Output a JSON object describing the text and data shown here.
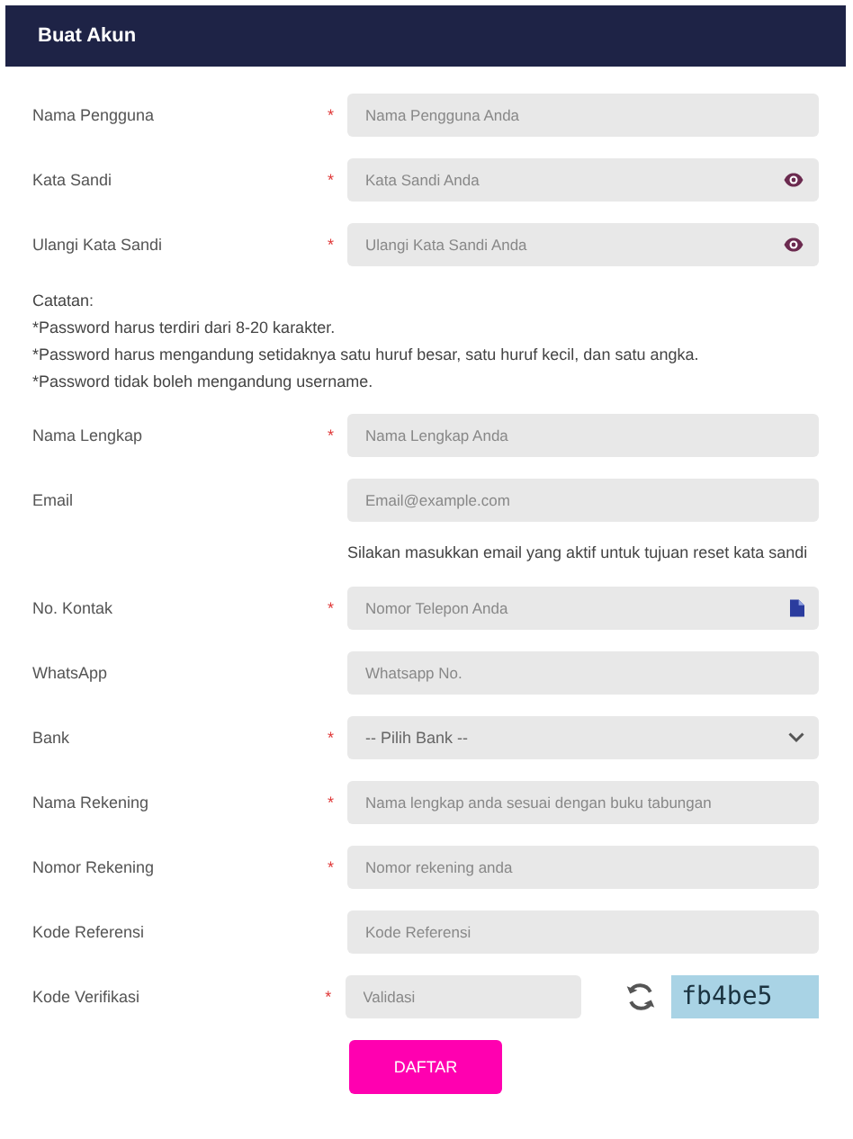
{
  "header": {
    "title": "Buat Akun"
  },
  "form": [
    {
      "kind": "input",
      "label": "Nama Pengguna",
      "mark": "*",
      "placeholder": "Nama Pengguna Anda"
    },
    {
      "kind": "password",
      "label": "Kata Sandi",
      "mark": "*",
      "placeholder": "Kata Sandi Anda"
    },
    {
      "kind": "password",
      "label": "Ulangi Kata Sandi",
      "mark": "*",
      "placeholder": "Ulangi Kata Sandi Anda"
    },
    {
      "kind": "notes",
      "lines": [
        "Catatan:",
        "*Password harus terdiri dari 8-20 karakter.",
        "*Password harus mengandung setidaknya satu huruf besar, satu huruf kecil, dan satu angka.",
        "*Password tidak boleh mengandung username."
      ]
    },
    {
      "kind": "input",
      "label": "Nama Lengkap",
      "mark": "*",
      "placeholder": "Nama Lengkap Anda"
    },
    {
      "kind": "input",
      "label": "Email",
      "placeholder": "Email@example.com"
    },
    {
      "kind": "help",
      "text": "Silakan masukkan email yang aktif untuk tujuan reset kata sandi"
    },
    {
      "kind": "phone",
      "label": "No. Kontak",
      "mark": "*",
      "placeholder": "Nomor Telepon Anda"
    },
    {
      "kind": "input",
      "label": "WhatsApp",
      "placeholder": "Whatsapp No."
    },
    {
      "kind": "select",
      "label": "Bank",
      "mark": "*",
      "value": "-- Pilih Bank --"
    },
    {
      "kind": "input",
      "label": "Nama Rekening",
      "mark": "*",
      "placeholder": "Nama lengkap anda sesuai dengan buku tabungan"
    },
    {
      "kind": "input",
      "label": "Nomor Rekening",
      "mark": "*",
      "placeholder": "Nomor rekening anda"
    },
    {
      "kind": "input",
      "label": "Kode Referensi",
      "placeholder": "Kode Referensi"
    },
    {
      "kind": "captcha",
      "label": "Kode Verifikasi",
      "mark": "*",
      "placeholder": "Validasi",
      "code": "fb4be5"
    }
  ],
  "submit": {
    "label": "DAFTAR"
  }
}
